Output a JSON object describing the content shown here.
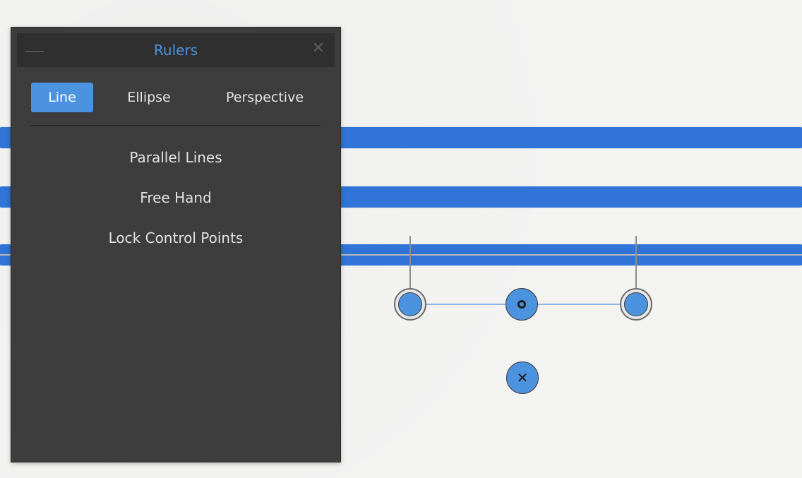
{
  "panel": {
    "title": "Rulers",
    "tabs": [
      {
        "label": "Line",
        "active": true
      },
      {
        "label": "Ellipse",
        "active": false
      },
      {
        "label": "Perspective",
        "active": false
      }
    ],
    "options": [
      {
        "label": "Parallel Lines"
      },
      {
        "label": "Free Hand"
      },
      {
        "label": "Lock Control Points"
      }
    ]
  },
  "colors": {
    "accent": "#4c93df",
    "stroke": "#2f74d6",
    "panel_bg": "#3d3d3d",
    "titlebar_bg": "#2f2f2f",
    "canvas_bg": "#f3f3f2"
  },
  "icons": {
    "minimize": "minimize-icon",
    "close": "close-icon",
    "center_handle": "center-handle-icon",
    "delete_handle": "delete-ruler-icon"
  }
}
